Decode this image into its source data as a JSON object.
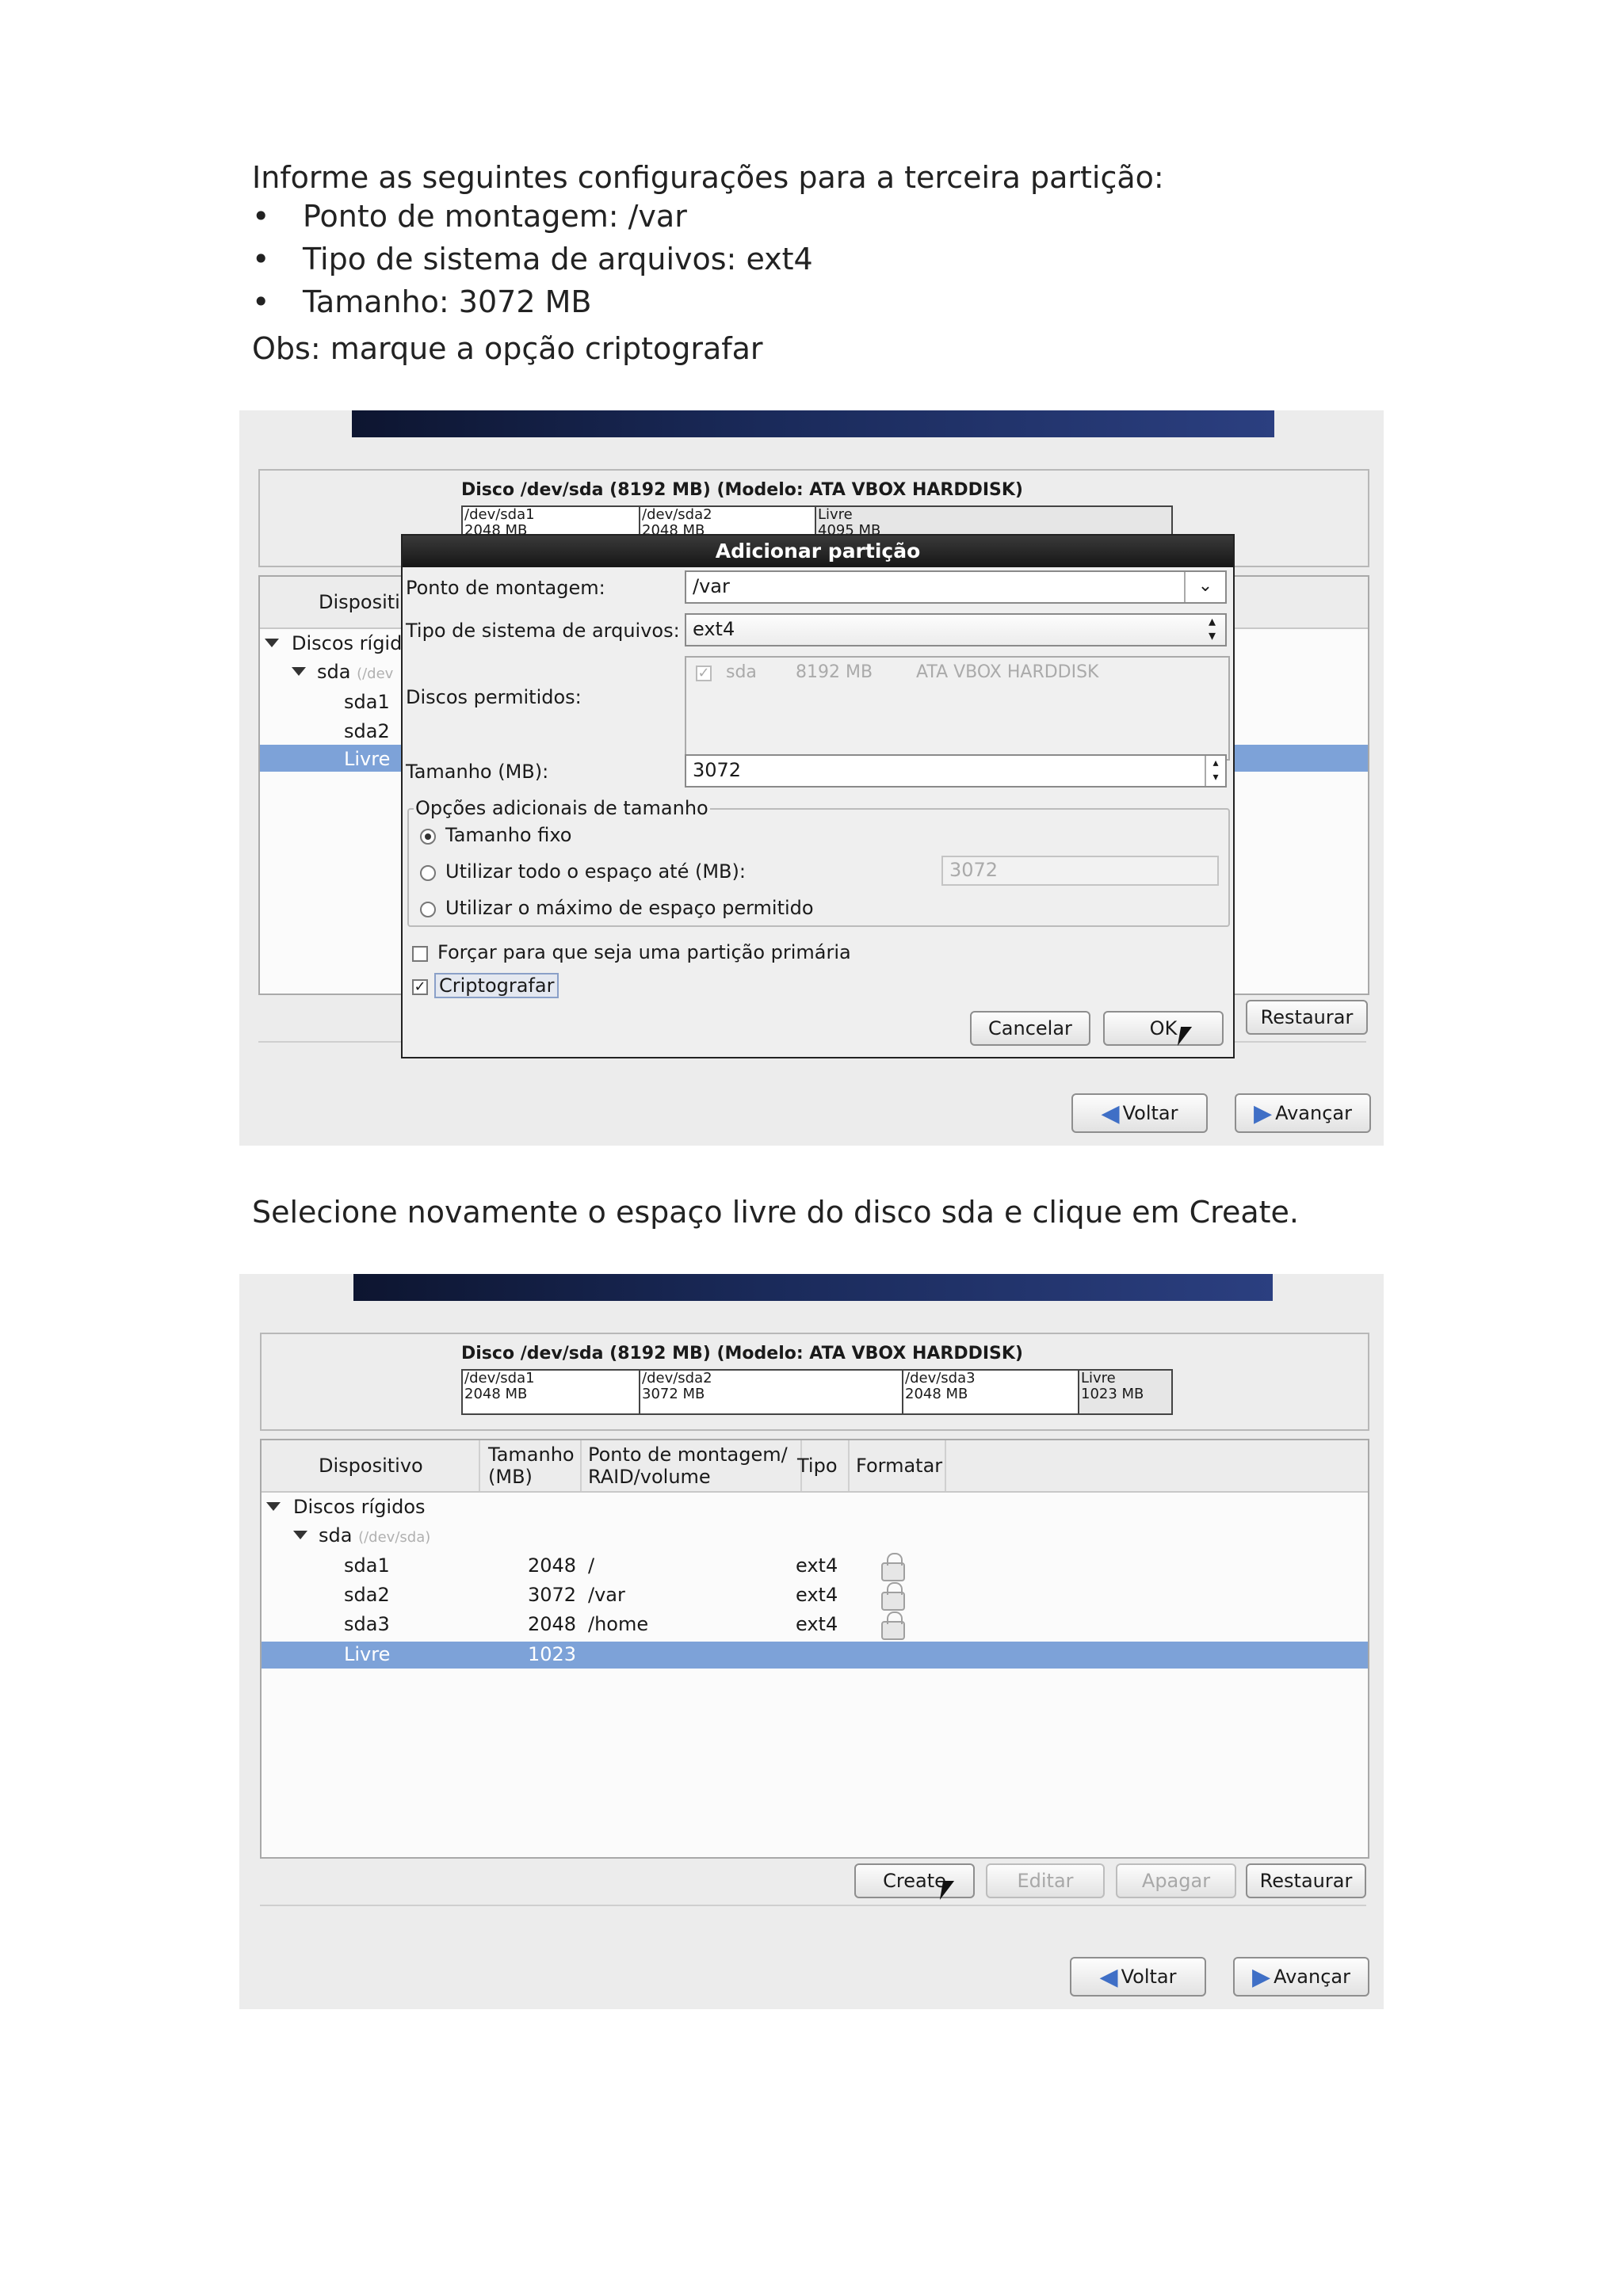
{
  "intro": {
    "line": "Informe as seguintes configurações para a terceira partição:",
    "bullets": [
      "Ponto de montagem: /var",
      "Tipo de sistema de arquivos: ext4",
      "Tamanho: 3072 MB"
    ],
    "note": "Obs: marque a opção criptografar"
  },
  "shot1": {
    "disk_title": "Disco /dev/sda (8192 MB) (Modelo: ATA VBOX HARDDISK)",
    "segments": [
      {
        "name": "/dev/sda1",
        "size": "2048 MB"
      },
      {
        "name": "/dev/sda2",
        "size": "2048 MB"
      },
      {
        "name": "Livre",
        "size": "4095 MB"
      }
    ],
    "col_device": "Dispositi",
    "tree": {
      "root": "Discos rígid",
      "disk": "sda",
      "disk_path": "(/dev",
      "items": [
        "sda1",
        "sda2",
        "Livre"
      ]
    },
    "dialog": {
      "title": "Adicionar partição",
      "mount_label": "Ponto de montagem:",
      "mount_value": "/var",
      "fstype_label": "Tipo de sistema de arquivos:",
      "fstype_value": "ext4",
      "drives_label": "Discos permitidos:",
      "drive": {
        "name": "sda",
        "size": "8192 MB",
        "model": "ATA VBOX HARDDISK",
        "checked": true
      },
      "size_label": "Tamanho (MB):",
      "size_value": "3072",
      "opts_group": "Opções adicionais de tamanho",
      "opt_fixed": "Tamanho fixo",
      "opt_upto": "Utilizar todo o espaço até (MB):",
      "opt_upto_value": "3072",
      "opt_max": "Utilizar o máximo de espaço permitido",
      "force_primary": "Forçar para que seja uma partição primária",
      "encrypt": "Criptografar",
      "cancel": "Cancelar",
      "ok": "OK"
    },
    "restore": "Restaurar",
    "back": "Voltar",
    "next": "Avançar"
  },
  "middle_text": "Selecione novamente o espaço livre do disco sda e clique em Create.",
  "shot2": {
    "disk_title": "Disco /dev/sda (8192 MB) (Modelo: ATA VBOX HARDDISK)",
    "segments": [
      {
        "name": "/dev/sda1",
        "size": "2048 MB"
      },
      {
        "name": "/dev/sda2",
        "size": "3072 MB"
      },
      {
        "name": "/dev/sda3",
        "size": "2048 MB"
      },
      {
        "name": "Livre",
        "size": "1023 MB"
      }
    ],
    "headers": {
      "device": "Dispositivo",
      "size1": "Tamanho",
      "size2": "(MB)",
      "mount1": "Ponto de montagem/",
      "mount2": "RAID/volume",
      "type": "Tipo",
      "format": "Formatar"
    },
    "tree_root": "Discos rígidos",
    "disk": "sda",
    "disk_path": "(/dev/sda)",
    "rows": [
      {
        "device": "sda1",
        "size": "2048",
        "mount": "/",
        "type": "ext4"
      },
      {
        "device": "sda2",
        "size": "3072",
        "mount": "/var",
        "type": "ext4"
      },
      {
        "device": "sda3",
        "size": "2048",
        "mount": "/home",
        "type": "ext4"
      },
      {
        "device": "Livre",
        "size": "1023",
        "mount": "",
        "type": ""
      }
    ],
    "buttons": {
      "create": "Create",
      "edit": "Editar",
      "delete": "Apagar",
      "restore": "Restaurar"
    },
    "back": "Voltar",
    "next": "Avançar"
  }
}
